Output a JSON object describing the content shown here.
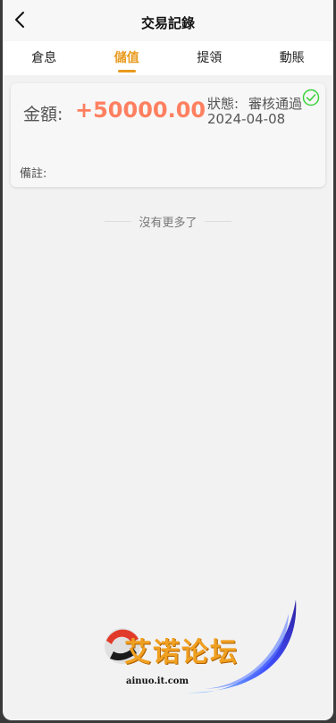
{
  "header": {
    "title": "交易記錄"
  },
  "tabs": [
    {
      "label": "倉息",
      "active": false
    },
    {
      "label": "儲值",
      "active": true
    },
    {
      "label": "提領",
      "active": false
    },
    {
      "label": "動賬",
      "active": false
    }
  ],
  "record": {
    "amount_label": "金額:",
    "amount_value": "+50000.00",
    "status_label": "狀態:",
    "status_value": "審核通過",
    "date": "2024-04-08",
    "note_label": "備註:"
  },
  "list_end_text": "沒有更多了",
  "watermark": {
    "text": "艾诺论坛",
    "url": "ainuo.it.com"
  },
  "colors": {
    "accent": "#e89a1d",
    "amount": "#ff8060",
    "success": "#3cd33c"
  }
}
